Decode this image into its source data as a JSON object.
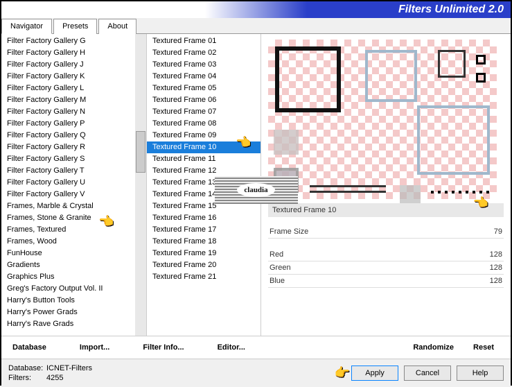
{
  "title": "Filters Unlimited 2.0",
  "tabs": [
    "Navigator",
    "Presets",
    "About"
  ],
  "active_tab": 0,
  "col1": [
    "Filter Factory Gallery G",
    "Filter Factory Gallery H",
    "Filter Factory Gallery J",
    "Filter Factory Gallery K",
    "Filter Factory Gallery L",
    "Filter Factory Gallery M",
    "Filter Factory Gallery N",
    "Filter Factory Gallery P",
    "Filter Factory Gallery Q",
    "Filter Factory Gallery R",
    "Filter Factory Gallery S",
    "Filter Factory Gallery T",
    "Filter Factory Gallery U",
    "Filter Factory Gallery V",
    "Frames, Marble & Crystal",
    "Frames, Stone & Granite",
    "Frames, Textured",
    "Frames, Wood",
    "FunHouse",
    "Gradients",
    "Graphics Plus",
    "Greg's Factory Output Vol. II",
    "Harry's Button Tools",
    "Harry's Power Grads",
    "Harry's Rave Grads"
  ],
  "col2": [
    "Textured Frame 01",
    "Textured Frame 02",
    "Textured Frame 03",
    "Textured Frame 04",
    "Textured Frame 05",
    "Textured Frame 06",
    "Textured Frame 07",
    "Textured Frame 08",
    "Textured Frame 09",
    "Textured Frame 10",
    "Textured Frame 11",
    "Textured Frame 12",
    "Textured Frame 13",
    "Textured Frame 14",
    "Textured Frame 15",
    "Textured Frame 16",
    "Textured Frame 17",
    "Textured Frame 18",
    "Textured Frame 19",
    "Textured Frame 20",
    "Textured Frame 21"
  ],
  "col2_selected": 9,
  "preview_name": "Textured Frame 10",
  "watermark": "claudia",
  "params": [
    {
      "name": "Frame Size",
      "value": 79
    },
    {
      "name": "Red",
      "value": 128
    },
    {
      "name": "Green",
      "value": 128
    },
    {
      "name": "Blue",
      "value": 128
    }
  ],
  "footer1": {
    "database": "Database",
    "import": "Import...",
    "filterinfo": "Filter Info...",
    "editor": "Editor...",
    "randomize": "Randomize",
    "reset": "Reset"
  },
  "stats": {
    "db_label": "Database:",
    "db_value": "ICNET-Filters",
    "filters_label": "Filters:",
    "filters_value": "4255"
  },
  "buttons": {
    "apply": "Apply",
    "cancel": "Cancel",
    "help": "Help"
  }
}
